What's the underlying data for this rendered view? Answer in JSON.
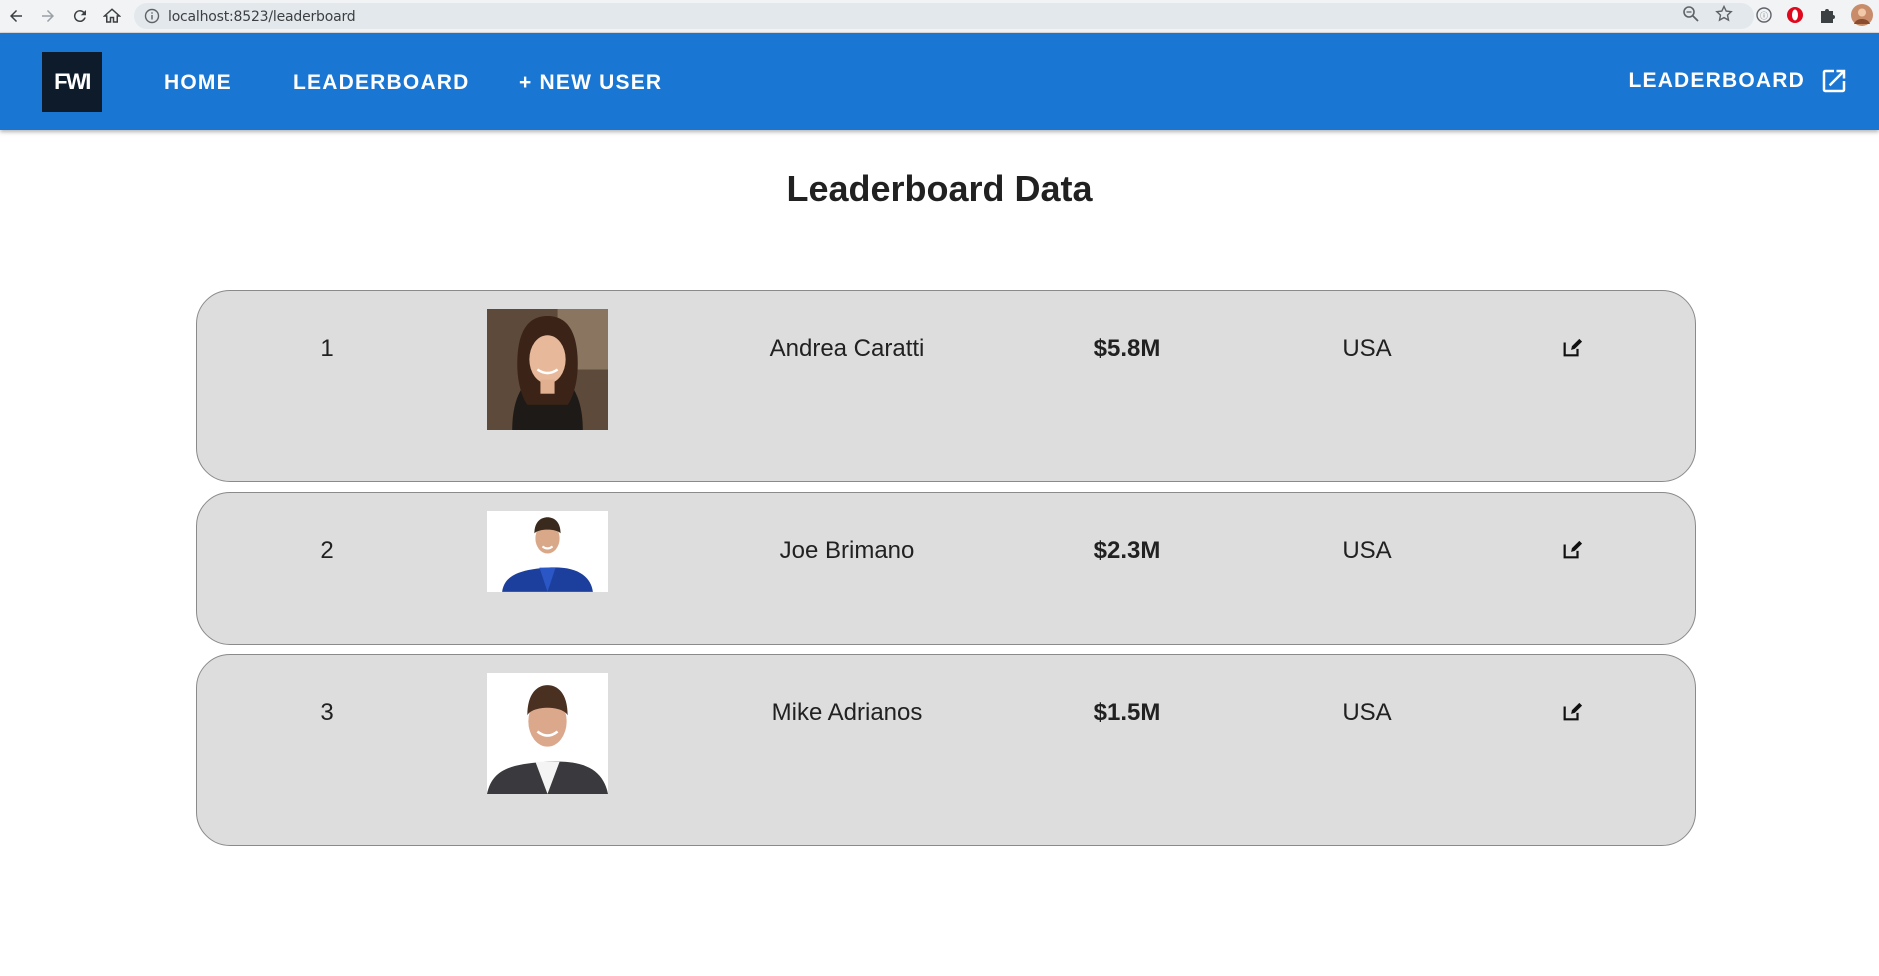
{
  "browser": {
    "url": "localhost:8523/leaderboard"
  },
  "app_bar": {
    "logo_text": "FWI",
    "nav": [
      {
        "label": "HOME"
      },
      {
        "label": "LEADERBOARD"
      },
      {
        "label": "+ NEW USER"
      }
    ],
    "right_link": "LEADERBOARD",
    "color": "#1976d2"
  },
  "page": {
    "title": "Leaderboard Data"
  },
  "rows": [
    {
      "rank": "1",
      "name": "Andrea Caratti",
      "amount": "$5.8M",
      "country": "USA",
      "avatar": "woman-portrait"
    },
    {
      "rank": "2",
      "name": "Joe Brimano",
      "amount": "$2.3M",
      "country": "USA",
      "avatar": "man-blue-uniform"
    },
    {
      "rank": "3",
      "name": "Mike Adrianos",
      "amount": "$1.5M",
      "country": "USA",
      "avatar": "man-suit"
    }
  ]
}
